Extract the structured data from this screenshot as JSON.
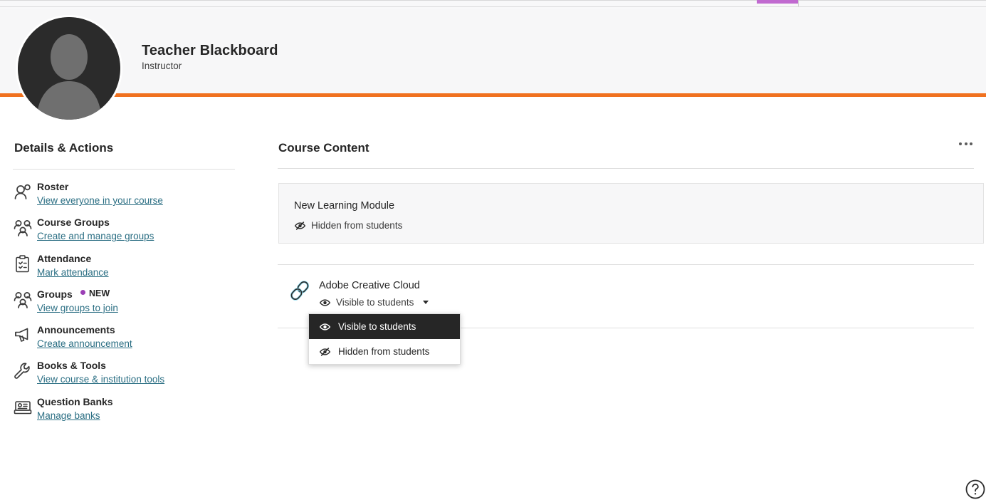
{
  "browser": {
    "tab_accent_color": "#c16ad0"
  },
  "theme": {
    "accent_orange": "#f0711f",
    "link_color": "#2a6e83",
    "badge_dot_color": "#9b3fb5",
    "selected_bg": "#262626",
    "link_icon_color": "#7fd4e8"
  },
  "profile": {
    "name": "Teacher Blackboard",
    "role": "Instructor",
    "avatar_icon": "person-avatar-icon"
  },
  "sidebar": {
    "title": "Details & Actions",
    "items": [
      {
        "icon": "roster-person-icon",
        "title": "Roster",
        "link": "View everyone in your course",
        "badge": null
      },
      {
        "icon": "course-groups-people-icon",
        "title": "Course Groups",
        "link": "Create and manage groups",
        "badge": null
      },
      {
        "icon": "attendance-clipboard-icon",
        "title": "Attendance",
        "link": "Mark attendance",
        "badge": null
      },
      {
        "icon": "groups-people-icon",
        "title": "Groups",
        "link": "View groups to join",
        "badge": "NEW"
      },
      {
        "icon": "announcements-megaphone-icon",
        "title": "Announcements",
        "link": "Create announcement",
        "badge": null
      },
      {
        "icon": "books-tools-wrench-icon",
        "title": "Books & Tools",
        "link": "View course & institution tools",
        "badge": null
      },
      {
        "icon": "question-banks-card-icon",
        "title": "Question Banks",
        "link": "Manage banks",
        "badge": null
      }
    ]
  },
  "main": {
    "title": "Course Content",
    "overflow_menu_icon": "more-options-icon",
    "module": {
      "title": "New Learning Module",
      "status": "Hidden from students",
      "status_icon": "eye-hidden-icon",
      "overflow_menu_icon": "more-options-icon",
      "expand_icon": "chevron-down-icon"
    },
    "link_item": {
      "icon": "chain-link-icon",
      "title": "Adobe Creative Cloud",
      "status": "Visible to students",
      "status_icon": "eye-visible-icon",
      "caret_icon": "caret-down-icon",
      "overflow_menu_icon": "more-options-icon"
    },
    "visibility_dropdown": {
      "open": true,
      "options": [
        {
          "label": "Visible to students",
          "icon": "eye-visible-icon",
          "selected": true
        },
        {
          "label": "Hidden from students",
          "icon": "eye-hidden-icon",
          "selected": false
        }
      ]
    }
  },
  "help": {
    "icon": "help-question-icon",
    "label": "Help"
  }
}
